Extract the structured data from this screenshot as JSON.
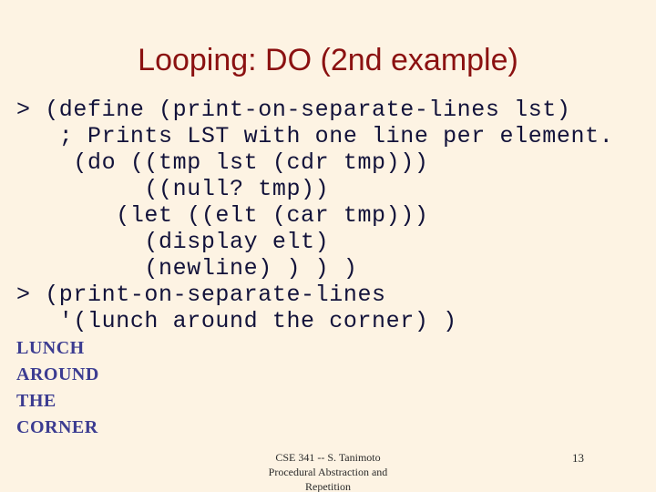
{
  "slide": {
    "background_color": "#fdf3e3",
    "title": "Looping: DO (2nd example)",
    "title_color": "#8b1111"
  },
  "code": {
    "text_color": "#12123a",
    "lines": [
      "> (define (print-on-separate-lines lst)",
      "   ; Prints LST with one line per element.",
      "    (do ((tmp lst (cdr tmp)))",
      "         ((null? tmp))",
      "       (let ((elt (car tmp)))",
      "         (display elt)",
      "         (newline) ) ) )",
      "> (print-on-separate-lines",
      "   '(lunch around the corner) )"
    ]
  },
  "output": {
    "text_color": "#3c3c91",
    "lines": [
      "LUNCH",
      "AROUND",
      "THE",
      "CORNER"
    ]
  },
  "footer": {
    "lines": [
      "CSE 341 -- S. Tanimoto",
      "Procedural Abstraction and",
      "Repetition"
    ],
    "page_number": "13"
  }
}
